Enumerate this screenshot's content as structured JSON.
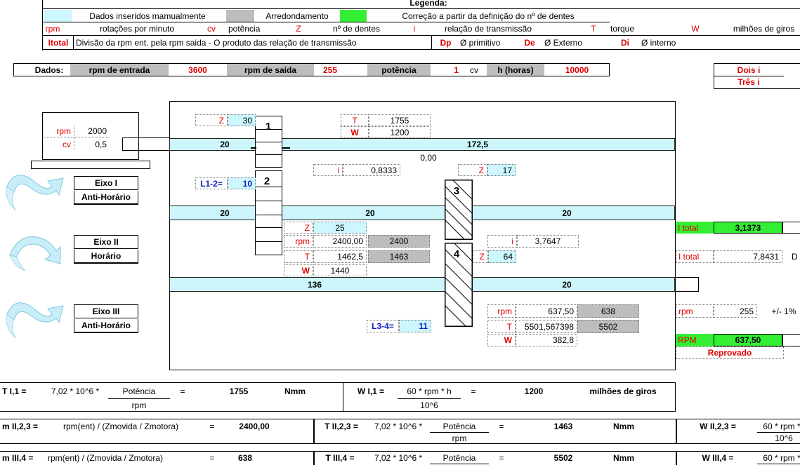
{
  "legend": {
    "title": "Legenda:",
    "manual": "Dados inseridos mamualmente",
    "rounding": "Arredondamento",
    "correction": "Correção a partir da definição do nº de dentes",
    "rpm_sym": "rpm",
    "rpm_desc": "rotações por minuto",
    "cv_sym": "cv",
    "cv_desc": "potência",
    "z_sym": "Z",
    "z_desc": "nº de dentes",
    "i_sym": "i",
    "i_desc": "relação de transmissão",
    "t_sym": "T",
    "t_desc": "torque",
    "w_sym": "W",
    "w_desc": "milhões de giros",
    "itotal_sym": "Itotal",
    "itotal_desc": "Divisão da rpm ent. pela rpm saida - O produto das relação de transmissão",
    "dp_sym": "Dp",
    "dp_desc": "Ø primitivo",
    "de_sym": "De",
    "de_desc": "Ø Externo",
    "di_sym": "Di",
    "di_desc": "Ø interno"
  },
  "dados": {
    "label": "Dados:",
    "rpm_in_label": "rpm de entrada",
    "rpm_in": "3600",
    "rpm_out_label": "rpm de saída",
    "rpm_out": "255",
    "power_label": "potência",
    "power": "1",
    "power_unit": "cv",
    "hours_label": "h (horas)",
    "hours": "10000"
  },
  "side_options": {
    "dois": "Dois i",
    "tres": "Três i"
  },
  "motor": {
    "rpm_label": "rpm",
    "rpm": "2000",
    "cv_label": "cv",
    "cv": "0,5"
  },
  "axes": [
    {
      "name": "Eixo I",
      "dir": "Anti-Horário"
    },
    {
      "name": "Eixo II",
      "dir": "Horário"
    },
    {
      "name": "Eixo III",
      "dir": "Anti-Horário"
    }
  ],
  "gears": {
    "g1": "1",
    "g2": "2",
    "g3": "3",
    "g4": "4"
  },
  "stage1": {
    "z_label": "Z",
    "z": "30",
    "t_label": "T",
    "t": "1755",
    "w_label": "W",
    "w": "1200",
    "shaft_left": "20",
    "shaft_right": "172,5",
    "zero": "0,00",
    "i_label": "i",
    "i": "0,8333",
    "z2_label": "Z",
    "z2": "17",
    "l12_label": "L1-2=",
    "l12": "10"
  },
  "stage2": {
    "shaft_a": "20",
    "shaft_b": "20",
    "shaft_c": "20",
    "z_label": "Z",
    "z": "25",
    "rpm_label": "rpm",
    "rpm": "2400,00",
    "rpm_round": "2400",
    "t_label": "T",
    "t": "1462,5",
    "t_round": "1463",
    "w_label": "W",
    "w": "1440",
    "i_label": "i",
    "i": "3,7647",
    "z4_label": "Z",
    "z4": "64"
  },
  "stage3": {
    "shaft_a": "136",
    "shaft_b": "20",
    "l34_label": "L3-4=",
    "l34": "11",
    "rpm_label": "rpm",
    "rpm": "637,50",
    "rpm_round": "638",
    "t_label": "T",
    "t": "5501,567398",
    "t_round": "5502",
    "w_label": "W",
    "w": "382,8"
  },
  "results": {
    "itotal1_label": "I total",
    "itotal1": "3,1373",
    "itotal2_label": "I total",
    "itotal2": "7,8431",
    "itotal2_suffix": "D",
    "rpm_label": "rpm",
    "rpm": "255",
    "tolerance": "+/- 1%",
    "RPM_label": "RPM",
    "RPM": "637,50",
    "status": "Reprovado"
  },
  "formulas": {
    "t11": "T I,1 =",
    "t11_const": "7,02 * 10^6 *",
    "t11_num": "Potência",
    "t11_den": "rpm",
    "t11_eq": "=",
    "t11_val": "1755",
    "t11_unit": "Nmm",
    "w11": "W I,1 =",
    "w11_num": "60 * rpm * h",
    "w11_den": "10^6",
    "w11_eq": "=",
    "w11_val": "1200",
    "w11_unit": "milhões de giros",
    "n23": "m II,2,3 =",
    "n23_expr": "rpm(ent) / (Zmovida / Zmotora)",
    "n23_eq": "=",
    "n23_val": "2400,00",
    "t23": "T II,2,3 =",
    "t23_const": "7,02 * 10^6 *",
    "t23_num": "Potência",
    "t23_den": "rpm",
    "t23_eq": "=",
    "t23_val": "1463",
    "t23_unit": "Nmm",
    "w23": "W II,2,3 =",
    "w23_num": "60 * rpm *",
    "w23_den": "10^6",
    "n34": "m III,4 =",
    "n34_expr": "rpm(ent) / (Zmovida / Zmotora)",
    "n34_eq": "=",
    "n34_val": "638",
    "t34": "T III,4 =",
    "t34_const": "7,02 * 10^6 *",
    "t34_num": "Potência",
    "t34_eq": "=",
    "t34_val": "5502",
    "t34_unit": "Nmm",
    "w34": "W III,4 =",
    "w34_num": "60 * rpm *"
  },
  "colors": {
    "cyan": "#ccf7ff",
    "gray": "#bdbdbd",
    "green": "#33ee33",
    "red": "#e00000",
    "blue": "#1020c0"
  }
}
